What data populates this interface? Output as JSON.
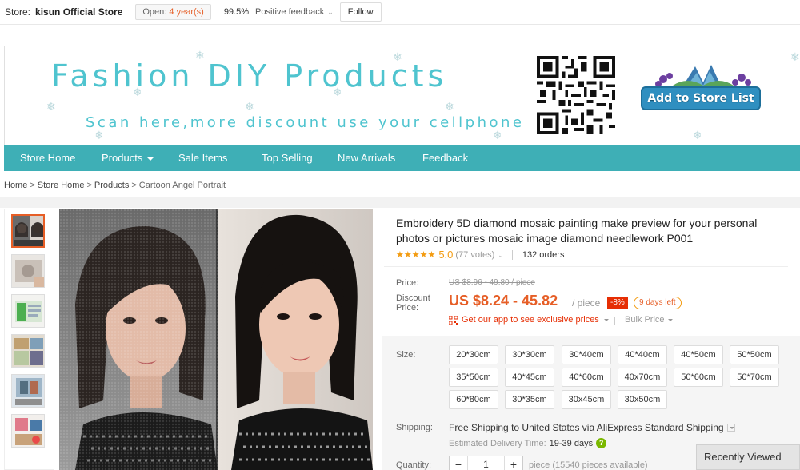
{
  "store_bar": {
    "store_label": "Store:",
    "store_name": "kisun Official Store",
    "open_label": "Open:",
    "open_years": "4 year(s)",
    "feedback_pct": "99.5%",
    "feedback_label": "Positive feedback",
    "follow_label": "Follow"
  },
  "banner": {
    "title": "Fashion DIY Products",
    "subtitle": "Scan here,more discount use your cellphone",
    "add_store_label": "Add to Store List"
  },
  "nav": {
    "items": [
      {
        "label": "Store Home"
      },
      {
        "label": "Products"
      },
      {
        "label": "Sale Items"
      },
      {
        "label": "Top Selling"
      },
      {
        "label": "New Arrivals"
      },
      {
        "label": "Feedback"
      }
    ]
  },
  "breadcrumb": {
    "items": [
      "Home",
      "Store Home",
      "Products",
      "Cartoon Angel Portrait"
    ],
    "separator": ">"
  },
  "product": {
    "title": "Embroidery 5D diamond mosaic painting make preview for your personal photos or pictures mosaic image diamond needlework P001",
    "stars": "★★★★★",
    "rating": "5.0",
    "votes": "(77 votes)",
    "orders": "132 orders",
    "price_label": "Price:",
    "old_price": "US $8.96 - 49.80 / piece",
    "discount_label": "Discount Price:",
    "new_price": "US $8.24 - 45.82",
    "per_piece": "/ piece",
    "discount": "-8%",
    "days_left": "9 days left",
    "app_promo": "Get our app to see exclusive prices",
    "bulk_price": "Bulk Price",
    "size_label": "Size:",
    "sizes": [
      "20*30cm",
      "30*30cm",
      "30*40cm",
      "40*40cm",
      "40*50cm",
      "50*50cm",
      "35*50cm",
      "40*45cm",
      "40*60cm",
      "40x70cm",
      "50*60cm",
      "50*70cm",
      "60*80cm",
      "30*35cm",
      "30x45cm",
      "30x50cm"
    ],
    "shipping_label": "Shipping:",
    "shipping_free": "Free Shipping",
    "shipping_to": "to",
    "shipping_country": "United States via AliExpress Standard Shipping",
    "est_label": "Estimated Delivery Time:",
    "est_days": "19-39 days",
    "quantity_label": "Quantity:",
    "quantity_value": "1",
    "qty_minus": "−",
    "qty_plus": "+",
    "quantity_note": "piece (15540 pieces available)"
  },
  "recently_viewed": "Recently Viewed",
  "colors": {
    "nav_bg": "#3eafb6",
    "banner_text": "#4fc4cf",
    "price_orange": "#e65e26",
    "discount_red": "#e62e04",
    "star": "#f39c12"
  }
}
